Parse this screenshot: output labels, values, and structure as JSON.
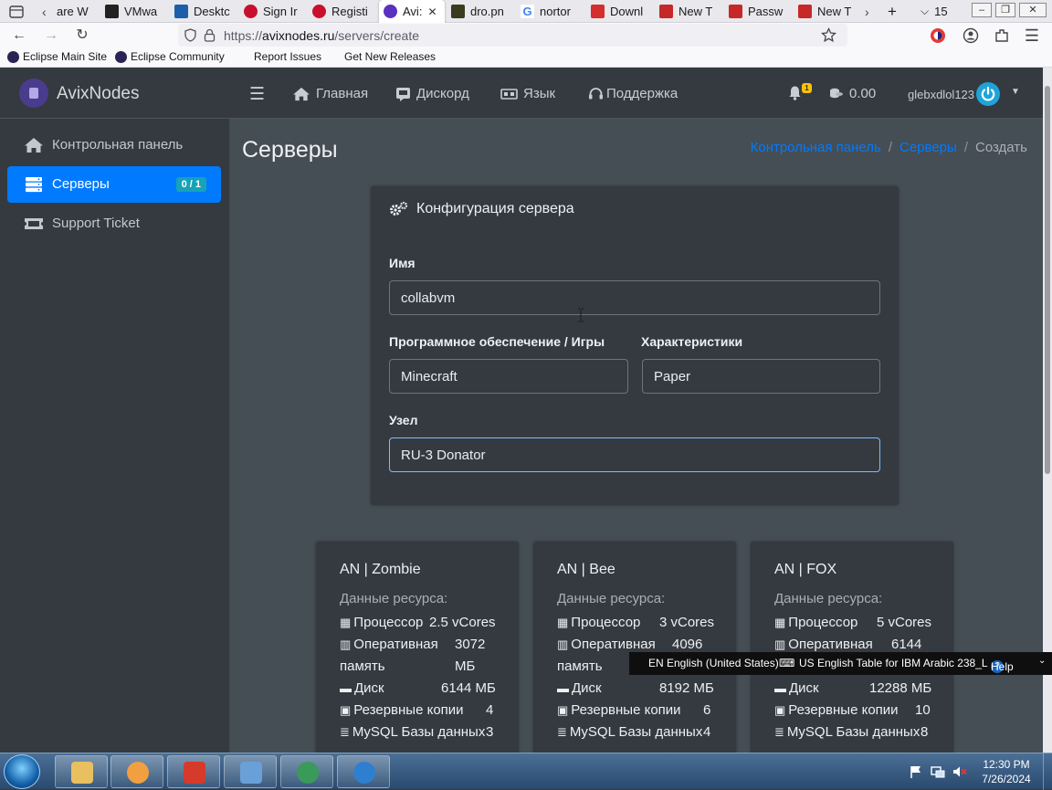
{
  "browser": {
    "tabs": [
      {
        "label": "are W"
      },
      {
        "label": "VMwa"
      },
      {
        "label": "Desktc"
      },
      {
        "label": "Sign Ir"
      },
      {
        "label": "Registi"
      },
      {
        "label": "Avi:",
        "active": true
      },
      {
        "label": "dro.pn"
      },
      {
        "label": "nortor"
      },
      {
        "label": "Downl"
      },
      {
        "label": "New T"
      },
      {
        "label": "Passw"
      },
      {
        "label": "New T"
      }
    ],
    "tab_count": "15",
    "url_prefix": "https://",
    "url_host": "avixnodes.ru",
    "url_path": "/servers/create",
    "bookmarks": [
      "Eclipse Main Site",
      "Eclipse Community",
      "Report Issues",
      "Get New Releases"
    ]
  },
  "app": {
    "brand": "AvixNodes",
    "sidebar": [
      {
        "label": "Контрольная панель",
        "icon": "home-icon"
      },
      {
        "label": "Серверы",
        "icon": "server-icon",
        "badge": "0 / 1",
        "active": true
      },
      {
        "label": "Support Ticket",
        "icon": "ticket-icon"
      }
    ],
    "topnav": {
      "home": "Главная",
      "discord": "Дискорд",
      "language": "Язык",
      "support": "Поддержка",
      "notifications": "1",
      "credits": "0.00",
      "username": "glebxdlol123"
    },
    "page_title": "Серверы",
    "breadcrumb": [
      "Контрольная панель",
      "Серверы",
      "Создать"
    ]
  },
  "form": {
    "title": "Конфигурация сервера",
    "name_label": "Имя",
    "name_value": "collabvm",
    "software_label": "Программное обеспечение / Игры",
    "software_value": "Minecraft",
    "spec_label": "Характеристики",
    "spec_value": "Paper",
    "node_label": "Узел",
    "node_value": "RU-3 Donator"
  },
  "nodes": [
    {
      "name": "AN | Zombie",
      "subtitle": "Данные ресурса:",
      "cpu_label": "Процессор",
      "cpu": "2.5 vCores",
      "ram_label1": "Оперативная",
      "ram_label2": "память",
      "ram1": "3072",
      "ram2": "МБ",
      "disk_label": "Диск",
      "disk": "6144 МБ",
      "backups_label": "Резервные копии",
      "backups": "4",
      "mysql_label": "MySQL Базы данных",
      "mysql": "3"
    },
    {
      "name": "AN | Bee",
      "subtitle": "Данные ресурса:",
      "cpu_label": "Процессор",
      "cpu": "3 vCores",
      "ram_label1": "Оперативная",
      "ram_label2": "память",
      "ram1": "4096",
      "ram2": "",
      "disk_label": "Диск",
      "disk": "8192 МБ",
      "backups_label": "Резервные копии",
      "backups": "6",
      "mysql_label": "MySQL Базы данных",
      "mysql": "4"
    },
    {
      "name": "AN | FOX",
      "subtitle": "Данные ресурса:",
      "cpu_label": "Процессор",
      "cpu": "5 vCores",
      "ram_label1": "Оперативная",
      "ram_label2": "",
      "ram1": "6144",
      "ram2": "",
      "disk_label": "Диск",
      "disk": "12288 МБ",
      "backups_label": "Резервные копии",
      "backups": "10",
      "mysql_label": "MySQL Базы данных",
      "mysql": "8"
    }
  ],
  "language_bar": {
    "lang": "EN English (United States)",
    "layout": "US English Table for IBM Arabic 238_L",
    "help": "Help"
  },
  "taskbar": {
    "time": "12:30 PM",
    "date": "7/26/2024"
  },
  "colors": {
    "accent": "#007bff",
    "badge": "#17a2b8",
    "sidebar_bg": "#343a40",
    "content_bg": "#454d55"
  }
}
